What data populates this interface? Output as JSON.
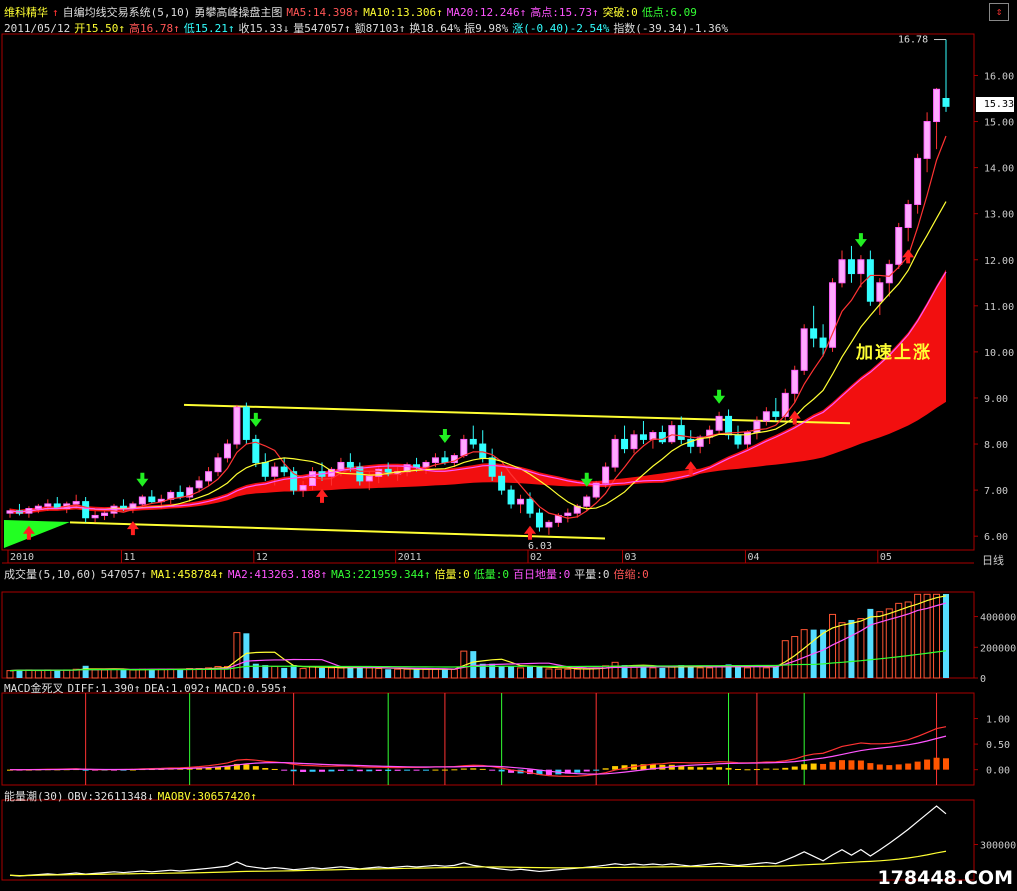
{
  "header": {
    "line1": [
      {
        "text": "维科精华",
        "color": "#ffff33"
      },
      {
        "text": "↑",
        "color": "#ff3333"
      },
      {
        "text": "自编均线交易系统(5,10)",
        "color": "#dddddd"
      },
      {
        "text": "勇攀高峰操盘主图",
        "color": "#dddddd"
      },
      {
        "text": "MA5:14.398↑",
        "color": "#ff5555"
      },
      {
        "text": "MA10:13.306↑",
        "color": "#ffff33"
      },
      {
        "text": "MA20:12.246↑",
        "color": "#ff55ff"
      },
      {
        "text": "高点:15.73↑",
        "color": "#ff55ff"
      },
      {
        "text": "突破:0",
        "color": "#ffff33"
      },
      {
        "text": "低点:6.09",
        "color": "#33ff33"
      }
    ],
    "line2": [
      {
        "text": "2011/05/12",
        "color": "#dddddd"
      },
      {
        "text": "开15.50↑",
        "color": "#ffff33"
      },
      {
        "text": "高16.78↑",
        "color": "#ff5555"
      },
      {
        "text": "低15.21↑",
        "color": "#33ffff"
      },
      {
        "text": "收15.33↓",
        "color": "#dddddd"
      },
      {
        "text": "量547057↑",
        "color": "#dddddd"
      },
      {
        "text": "额87103↑",
        "color": "#dddddd"
      },
      {
        "text": "换18.64%",
        "color": "#dddddd"
      },
      {
        "text": "振9.98%",
        "color": "#dddddd"
      },
      {
        "text": "涨(-0.40)-2.54%",
        "color": "#33ffff"
      },
      {
        "text": "指数(-39.34)-1.36%",
        "color": "#dddddd"
      }
    ],
    "corner_icon": "scroll-arrow-icon"
  },
  "annotation": "加速上涨",
  "last_price": "15.33",
  "axis_name": "日线",
  "watermark": "178448.COM",
  "volume_header": [
    {
      "text": "成交量(5,10,60)",
      "color": "#dddddd"
    },
    {
      "text": "547057↑",
      "color": "#dddddd"
    },
    {
      "text": "MA1:458784↑",
      "color": "#ffff33"
    },
    {
      "text": "MA2:413263.188↑",
      "color": "#ff55ff"
    },
    {
      "text": "MA3:221959.344↑",
      "color": "#33ff33"
    },
    {
      "text": "倍量:0",
      "color": "#ffff33"
    },
    {
      "text": "低量:0",
      "color": "#33ff33"
    },
    {
      "text": "百日地量:0",
      "color": "#ff55ff"
    },
    {
      "text": "平量:0",
      "color": "#dddddd"
    },
    {
      "text": "倍缩:0",
      "color": "#ff5555"
    }
  ],
  "macd_header": [
    {
      "text": "MACD金死叉",
      "color": "#dddddd"
    },
    {
      "text": "DIFF:1.390↑",
      "color": "#dddddd"
    },
    {
      "text": "DEA:1.092↑",
      "color": "#dddddd"
    },
    {
      "text": "MACD:0.595↑",
      "color": "#dddddd"
    }
  ],
  "obv_header": [
    {
      "text": "能量潮(30)",
      "color": "#dddddd"
    },
    {
      "text": "OBV:32611348↓",
      "color": "#dddddd"
    },
    {
      "text": "MAOBV:30657420↑",
      "color": "#ffff33"
    }
  ],
  "chart_data": [
    {
      "type": "candlestick",
      "name": "price",
      "x_ticks": [
        "2010",
        "11",
        "12",
        "2011",
        "02",
        "03",
        "04",
        "05"
      ],
      "y_ticks": [
        "6.00",
        "7.00",
        "8.00",
        "9.00",
        "10.00",
        "11.00",
        "12.00",
        "13.00",
        "14.00",
        "15.00",
        "16.00"
      ],
      "ylim": [
        5.7,
        16.9
      ],
      "high_label": "16.78",
      "low_label": "6.03",
      "ohlc": [
        [
          6.5,
          6.6,
          6.4,
          6.55
        ],
        [
          6.55,
          6.7,
          6.45,
          6.5
        ],
        [
          6.5,
          6.65,
          6.4,
          6.6
        ],
        [
          6.6,
          6.7,
          6.5,
          6.65
        ],
        [
          6.65,
          6.8,
          6.55,
          6.7
        ],
        [
          6.7,
          6.85,
          6.6,
          6.6
        ],
        [
          6.6,
          6.75,
          6.5,
          6.7
        ],
        [
          6.7,
          6.9,
          6.6,
          6.75
        ],
        [
          6.75,
          6.85,
          6.3,
          6.4
        ],
        [
          6.4,
          6.55,
          6.3,
          6.45
        ],
        [
          6.45,
          6.6,
          6.35,
          6.5
        ],
        [
          6.5,
          6.7,
          6.4,
          6.65
        ],
        [
          6.65,
          6.8,
          6.55,
          6.6
        ],
        [
          6.6,
          6.75,
          6.5,
          6.7
        ],
        [
          6.7,
          6.9,
          6.6,
          6.85
        ],
        [
          6.85,
          7.0,
          6.7,
          6.75
        ],
        [
          6.75,
          6.9,
          6.6,
          6.8
        ],
        [
          6.8,
          7.0,
          6.7,
          6.95
        ],
        [
          6.95,
          7.1,
          6.8,
          6.85
        ],
        [
          6.85,
          7.1,
          6.75,
          7.05
        ],
        [
          7.05,
          7.3,
          6.95,
          7.2
        ],
        [
          7.2,
          7.5,
          7.1,
          7.4
        ],
        [
          7.4,
          7.8,
          7.3,
          7.7
        ],
        [
          7.7,
          8.1,
          7.6,
          8.0
        ],
        [
          8.0,
          8.85,
          7.9,
          8.8
        ],
        [
          8.8,
          8.9,
          8.0,
          8.1
        ],
        [
          8.1,
          8.2,
          7.5,
          7.6
        ],
        [
          7.6,
          7.8,
          7.2,
          7.3
        ],
        [
          7.3,
          7.6,
          7.1,
          7.5
        ],
        [
          7.5,
          7.7,
          7.3,
          7.4
        ],
        [
          7.4,
          7.5,
          6.9,
          7.0
        ],
        [
          7.0,
          7.2,
          6.85,
          7.1
        ],
        [
          7.1,
          7.5,
          7.0,
          7.4
        ],
        [
          7.4,
          7.6,
          7.2,
          7.3
        ],
        [
          7.3,
          7.5,
          7.1,
          7.45
        ],
        [
          7.45,
          7.7,
          7.3,
          7.6
        ],
        [
          7.6,
          7.8,
          7.4,
          7.5
        ],
        [
          7.5,
          7.6,
          7.1,
          7.2
        ],
        [
          7.2,
          7.4,
          7.0,
          7.3
        ],
        [
          7.3,
          7.5,
          7.15,
          7.45
        ],
        [
          7.45,
          7.6,
          7.3,
          7.35
        ],
        [
          7.35,
          7.5,
          7.2,
          7.4
        ],
        [
          7.4,
          7.6,
          7.3,
          7.55
        ],
        [
          7.55,
          7.7,
          7.4,
          7.5
        ],
        [
          7.5,
          7.65,
          7.35,
          7.6
        ],
        [
          7.6,
          7.8,
          7.5,
          7.7
        ],
        [
          7.7,
          7.85,
          7.55,
          7.6
        ],
        [
          7.6,
          7.8,
          7.5,
          7.75
        ],
        [
          7.75,
          8.2,
          7.7,
          8.1
        ],
        [
          8.1,
          8.4,
          7.9,
          8.0
        ],
        [
          8.0,
          8.3,
          7.6,
          7.7
        ],
        [
          7.7,
          7.9,
          7.2,
          7.3
        ],
        [
          7.3,
          7.4,
          6.9,
          7.0
        ],
        [
          7.0,
          7.1,
          6.6,
          6.7
        ],
        [
          6.7,
          6.9,
          6.5,
          6.8
        ],
        [
          6.8,
          6.95,
          6.4,
          6.5
        ],
        [
          6.5,
          6.6,
          6.1,
          6.2
        ],
        [
          6.2,
          6.35,
          6.03,
          6.3
        ],
        [
          6.3,
          6.5,
          6.2,
          6.45
        ],
        [
          6.45,
          6.6,
          6.3,
          6.5
        ],
        [
          6.5,
          6.7,
          6.4,
          6.65
        ],
        [
          6.65,
          6.9,
          6.55,
          6.85
        ],
        [
          6.85,
          7.2,
          6.8,
          7.15
        ],
        [
          7.15,
          7.6,
          7.05,
          7.5
        ],
        [
          7.5,
          8.2,
          7.4,
          8.1
        ],
        [
          8.1,
          8.4,
          7.8,
          7.9
        ],
        [
          7.9,
          8.3,
          7.8,
          8.2
        ],
        [
          8.2,
          8.5,
          8.0,
          8.1
        ],
        [
          8.1,
          8.3,
          7.9,
          8.25
        ],
        [
          8.25,
          8.4,
          8.0,
          8.05
        ],
        [
          8.05,
          8.5,
          8.0,
          8.4
        ],
        [
          8.4,
          8.6,
          8.0,
          8.1
        ],
        [
          8.1,
          8.3,
          7.8,
          7.95
        ],
        [
          7.95,
          8.2,
          7.8,
          8.15
        ],
        [
          8.15,
          8.4,
          8.0,
          8.3
        ],
        [
          8.3,
          8.7,
          8.2,
          8.6
        ],
        [
          8.6,
          8.75,
          8.1,
          8.2
        ],
        [
          8.2,
          8.4,
          7.9,
          8.0
        ],
        [
          8.0,
          8.3,
          7.9,
          8.25
        ],
        [
          8.25,
          8.6,
          8.1,
          8.5
        ],
        [
          8.5,
          8.8,
          8.4,
          8.7
        ],
        [
          8.7,
          9.0,
          8.5,
          8.6
        ],
        [
          8.6,
          9.2,
          8.5,
          9.1
        ],
        [
          9.1,
          9.7,
          8.9,
          9.6
        ],
        [
          9.6,
          10.6,
          9.5,
          10.5
        ],
        [
          10.5,
          11.0,
          10.1,
          10.3
        ],
        [
          10.3,
          10.6,
          9.9,
          10.1
        ],
        [
          10.1,
          11.6,
          10.0,
          11.5
        ],
        [
          11.5,
          12.2,
          11.4,
          12.0
        ],
        [
          12.0,
          12.3,
          11.5,
          11.7
        ],
        [
          11.7,
          12.1,
          11.4,
          12.0
        ],
        [
          12.0,
          12.2,
          11.0,
          11.1
        ],
        [
          11.1,
          11.6,
          10.8,
          11.5
        ],
        [
          11.5,
          12.0,
          11.2,
          11.9
        ],
        [
          11.9,
          12.8,
          11.8,
          12.7
        ],
        [
          12.7,
          13.3,
          12.4,
          13.2
        ],
        [
          13.2,
          14.3,
          13.0,
          14.2
        ],
        [
          14.2,
          15.2,
          13.9,
          15.0
        ],
        [
          15.0,
          15.73,
          14.4,
          15.7
        ],
        [
          15.5,
          16.78,
          15.21,
          15.33
        ]
      ]
    },
    {
      "type": "bar",
      "name": "volume",
      "y_ticks": [
        "0",
        "200000",
        "400000"
      ],
      "ylim": [
        0,
        560000
      ]
    },
    {
      "type": "line",
      "name": "macd",
      "series": [
        {
          "name": "DIFF"
        },
        {
          "name": "DEA"
        },
        {
          "name": "MACD"
        }
      ],
      "y_ticks": [
        "0.00",
        "0.50",
        "1.00"
      ],
      "ylim": [
        -0.3,
        1.5
      ]
    },
    {
      "type": "line",
      "name": "obv",
      "series": [
        {
          "name": "OBV"
        },
        {
          "name": "MAOBV"
        }
      ],
      "y_ticks": [
        "300000"
      ]
    }
  ]
}
